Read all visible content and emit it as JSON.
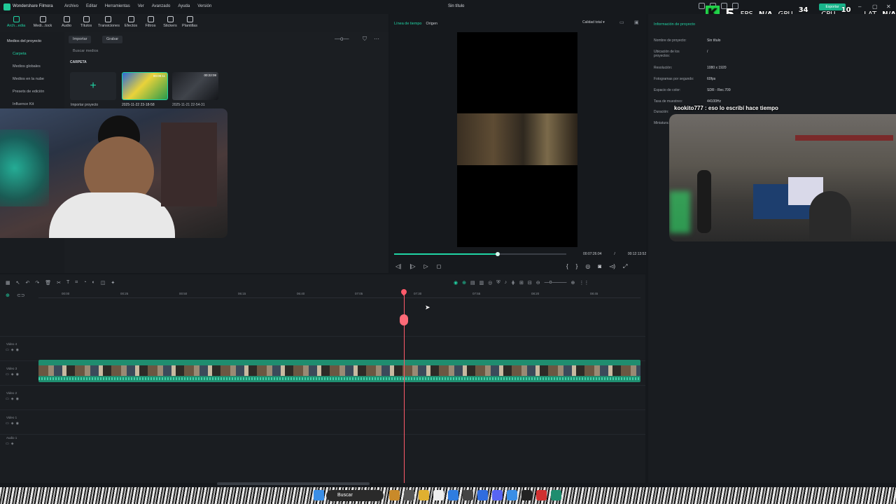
{
  "app": {
    "name": "Wondershare Filmora",
    "window_title": "Sin título",
    "menu": [
      "Archivo",
      "Editar",
      "Herramientas",
      "Ver",
      "Avanzado",
      "Ayuda",
      "Versión"
    ],
    "export_label": "Exportar"
  },
  "overlay": {
    "k_label": "K",
    "k_num": "5",
    "fps_label": "FPS",
    "fps_val": "N/A",
    "gpu_label": "GPU",
    "gpu_val": "34 %",
    "cpu_label": "CPU",
    "cpu_val": "10 %",
    "lat_label": "LAT",
    "lat_val": "N/A"
  },
  "toolbar": {
    "items": [
      "Arch...edia",
      "Medi...tock",
      "Audio",
      "Títulos",
      "Transiciones",
      "Efectos",
      "Filtros",
      "Stickers",
      "Plantillas"
    ]
  },
  "sidebar": {
    "items": [
      "Medios del proyecto",
      "Carpeta",
      "Medios globales",
      "Medios en la nube",
      "Presets de edición",
      "Influence Kit"
    ]
  },
  "media": {
    "import_label": "Importar",
    "record_label": "Grabar",
    "search_placeholder": "Buscar medios",
    "folder_label": "CARPETA",
    "import_project": "Importar proyecto",
    "thumb1_caption": "2025-11-22 23-18-58",
    "thumb1_duration": "00:08:11",
    "thumb2_caption": "2025-11-21 22-54-31",
    "thumb2_duration": "00:22:08"
  },
  "player": {
    "tab_timeline": "Línea de tiempo",
    "tab_origin": "Origen",
    "quality": "Calidad total",
    "current_time": "00:07:26:04",
    "separator": "/",
    "total_time": "00:12:13:52",
    "progress": 0.6
  },
  "info": {
    "header": "Información de proyecto",
    "rows": [
      {
        "label": "Nombre de proyecto:",
        "value": "Sin título"
      },
      {
        "label": "Ubicación de los proyectos:",
        "value": "/"
      },
      {
        "label": "Resolución:",
        "value": "1080 x 1920"
      },
      {
        "label": "Fotogramas por segundo:",
        "value": "60fps"
      },
      {
        "label": "Espacio de color:",
        "value": "SDR - Rec.709"
      },
      {
        "label": "Tasa de muestreo:",
        "value": "44100Hz"
      },
      {
        "label": "Duración:",
        "value": ""
      },
      {
        "label": "Miniatura:",
        "value": ""
      }
    ]
  },
  "chat": {
    "message": "kookito777 : eso lo escribí hace tiempo"
  },
  "timeline": {
    "ruler": [
      "00:00",
      "00:25",
      "00:50",
      "06:15",
      "06:40",
      "07:05",
      "07:30",
      "07:55",
      "08:20",
      "08:45"
    ],
    "tracks": [
      "Video 4",
      "Video 3",
      "Video 2",
      "Video 1",
      "Audio 1"
    ]
  },
  "taskbar": {
    "search_label": "Buscar"
  },
  "colors": {
    "accent": "#20d4a4",
    "playhead": "#ff5a6a",
    "clip": "#1f8d6f"
  }
}
